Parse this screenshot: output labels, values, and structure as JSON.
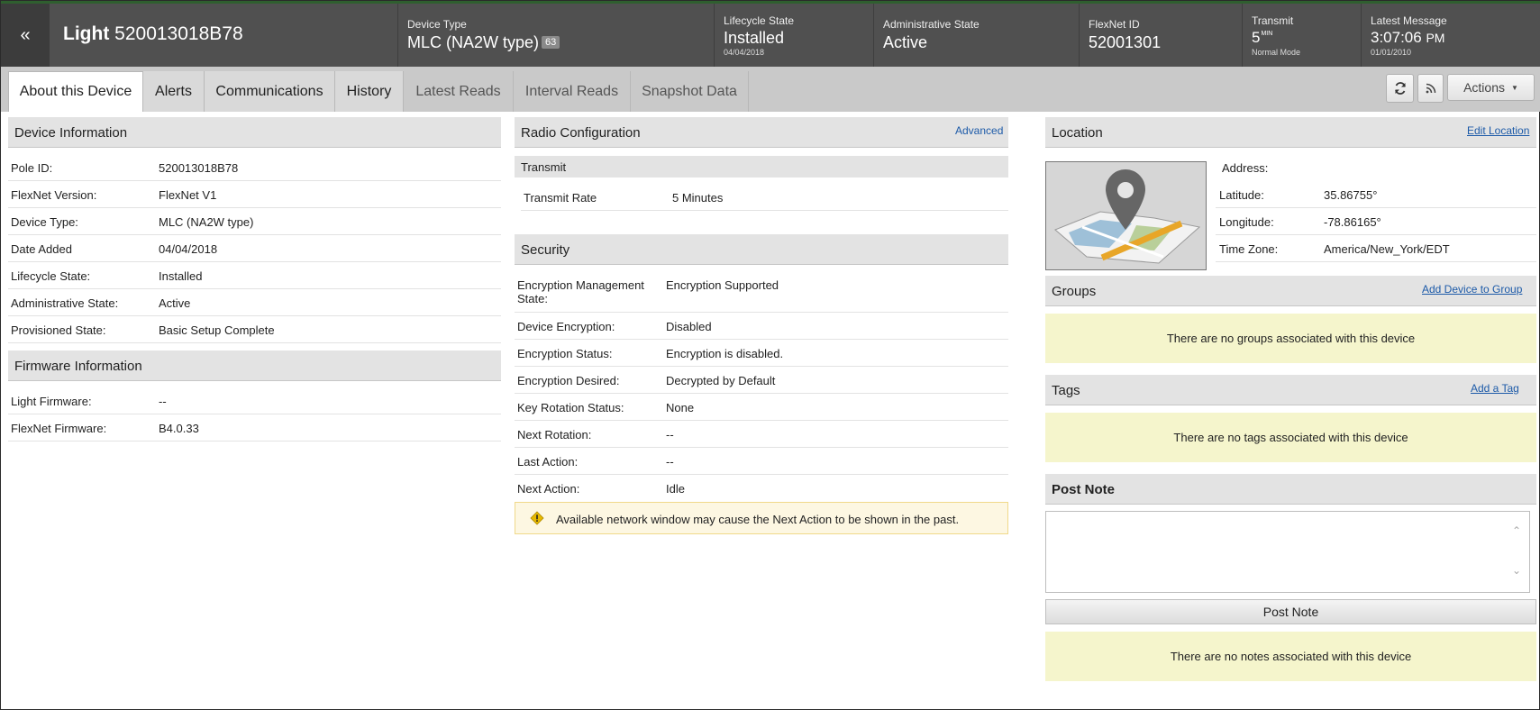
{
  "header": {
    "back_icon": "«",
    "title_bold": "Light",
    "title_id": "520013018B78",
    "device_type": {
      "label": "Device Type",
      "value": "MLC (NA2W type)",
      "badge": "63"
    },
    "lifecycle": {
      "label": "Lifecycle State",
      "value": "Installed",
      "sub": "04/04/2018"
    },
    "admin_state": {
      "label": "Administrative State",
      "value": "Active"
    },
    "flexnet_id": {
      "label": "FlexNet ID",
      "value": "52001301"
    },
    "transmit": {
      "label": "Transmit",
      "value": "5",
      "unit": "MIN",
      "sub": "Normal Mode"
    },
    "latest_message": {
      "label": "Latest Message",
      "time": "3:07:06",
      "ampm": "PM",
      "date": "01/01/2010"
    }
  },
  "tabs": [
    {
      "label": "About this Device"
    },
    {
      "label": "Alerts"
    },
    {
      "label": "Communications"
    },
    {
      "label": "History"
    },
    {
      "label": "Latest Reads"
    },
    {
      "label": "Interval Reads"
    },
    {
      "label": "Snapshot Data"
    }
  ],
  "toolbar": {
    "refresh_icon": "refresh-icon",
    "rss_icon": "rss-icon",
    "actions_label": "Actions"
  },
  "device_info": {
    "title": "Device Information",
    "rows": [
      {
        "k": "Pole ID:",
        "v": "520013018B78"
      },
      {
        "k": "FlexNet Version:",
        "v": "FlexNet V1"
      },
      {
        "k": "Device Type:",
        "v": "MLC (NA2W type)"
      },
      {
        "k": "Date Added",
        "v": "04/04/2018"
      },
      {
        "k": "Lifecycle State:",
        "v": "Installed"
      },
      {
        "k": "Administrative State:",
        "v": "Active"
      },
      {
        "k": "Provisioned State:",
        "v": "Basic Setup Complete"
      }
    ]
  },
  "firmware": {
    "title": "Firmware Information",
    "rows": [
      {
        "k": "Light Firmware:",
        "v": "--"
      },
      {
        "k": "FlexNet Firmware:",
        "v": "B4.0.33"
      }
    ]
  },
  "radio": {
    "title": "Radio Configuration",
    "advanced_link": "Advanced",
    "transmit_sub": "Transmit",
    "transmit_rate_label": "Transmit Rate",
    "transmit_rate_value": "5 Minutes"
  },
  "security": {
    "title": "Security",
    "rows": [
      {
        "k": "Encryption Management State:",
        "v": "Encryption Supported"
      },
      {
        "k": "Device Encryption:",
        "v": "Disabled"
      },
      {
        "k": "Encryption Status:",
        "v": "Encryption is disabled."
      },
      {
        "k": "Encryption Desired:",
        "v": "Decrypted by Default"
      },
      {
        "k": "Key Rotation Status:",
        "v": "None"
      },
      {
        "k": "Next Rotation:",
        "v": "--"
      },
      {
        "k": "Last Action:",
        "v": "--"
      },
      {
        "k": "Next Action:",
        "v": "Idle"
      }
    ],
    "notice": "Available network window may cause the Next Action to be shown in the past."
  },
  "location": {
    "title": "Location",
    "edit_link": "Edit Location",
    "rows": [
      {
        "k": "Address:",
        "v": ""
      },
      {
        "k": "Latitude:",
        "v": "35.86755°"
      },
      {
        "k": "Longitude:",
        "v": "-78.86165°"
      },
      {
        "k": "Time Zone:",
        "v": "America/New_York/EDT"
      }
    ]
  },
  "groups": {
    "title": "Groups",
    "link": "Add Device to Group",
    "empty": "There are no groups associated with this device"
  },
  "tags": {
    "title": "Tags",
    "link": "Add a Tag",
    "empty": "There are no tags associated with this device"
  },
  "notes": {
    "title": "Post Note",
    "textarea_value": "",
    "button": "Post Note",
    "empty": "There are no notes associated with this device"
  },
  "colors": {
    "header_bg": "#505050",
    "accent_link": "#1c5aa8",
    "info_bg": "#f5f5cc",
    "notice_bg": "#fdf7e2"
  }
}
